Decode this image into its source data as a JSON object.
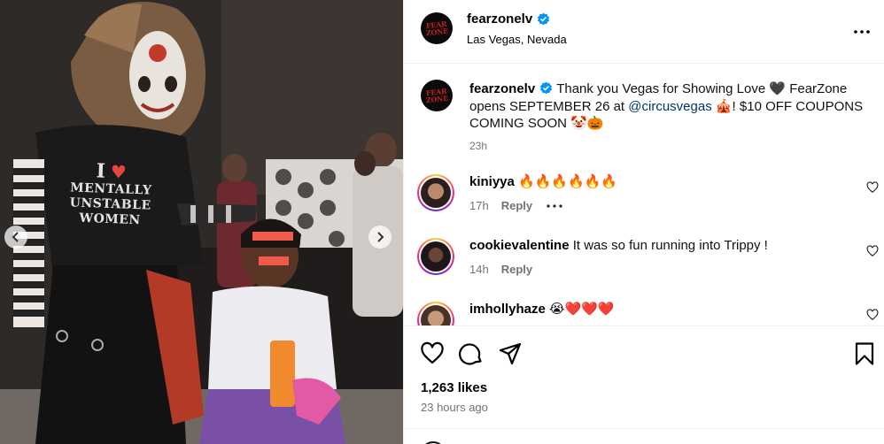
{
  "photo": {
    "shirt_line1": "I",
    "shirt_heart": "♥",
    "shirt_line2": "MENTALLY",
    "shirt_line3": "UNSTABLE",
    "shirt_line4": "WOMEN",
    "prev_icon": "chevron-left-icon",
    "next_icon": "chevron-right-icon"
  },
  "header": {
    "username": "fearzonelv",
    "location": "Las Vegas, Nevada",
    "avatar_text": "FEAR ZONE",
    "verified_icon": "verified-badge-icon",
    "more_icon": "more-options-icon"
  },
  "caption": {
    "username": "fearzonelv",
    "text_part1": "Thank you Vegas for Showing Love 🖤 FearZone opens SEPTEMBER 26 at",
    "mention": "@circusvegas",
    "text_part2": "🎪! $10 OFF COUPONS COMING SOON 🤡🎃",
    "time": "23h"
  },
  "comments": [
    {
      "username": "kiniyya",
      "text": "🔥🔥🔥🔥🔥🔥",
      "time": "17h",
      "reply": "Reply",
      "show_more": true
    },
    {
      "username": "cookievalentine",
      "text": "It was so fun running into Trippy !",
      "time": "14h",
      "reply": "Reply",
      "show_more": false
    },
    {
      "username": "imhollyhaze",
      "text": "😭❤️❤️❤️",
      "time": "",
      "reply": "",
      "show_more": false
    }
  ],
  "actions": {
    "like_icon": "heart-icon",
    "comment_icon": "comment-icon",
    "share_icon": "share-icon",
    "save_icon": "bookmark-icon",
    "likes": "1,263 likes",
    "posted": "23 hours ago"
  },
  "colors": {
    "link": "#00376b",
    "muted": "#737373",
    "verified": "#0095f6",
    "divider": "#efefef"
  }
}
